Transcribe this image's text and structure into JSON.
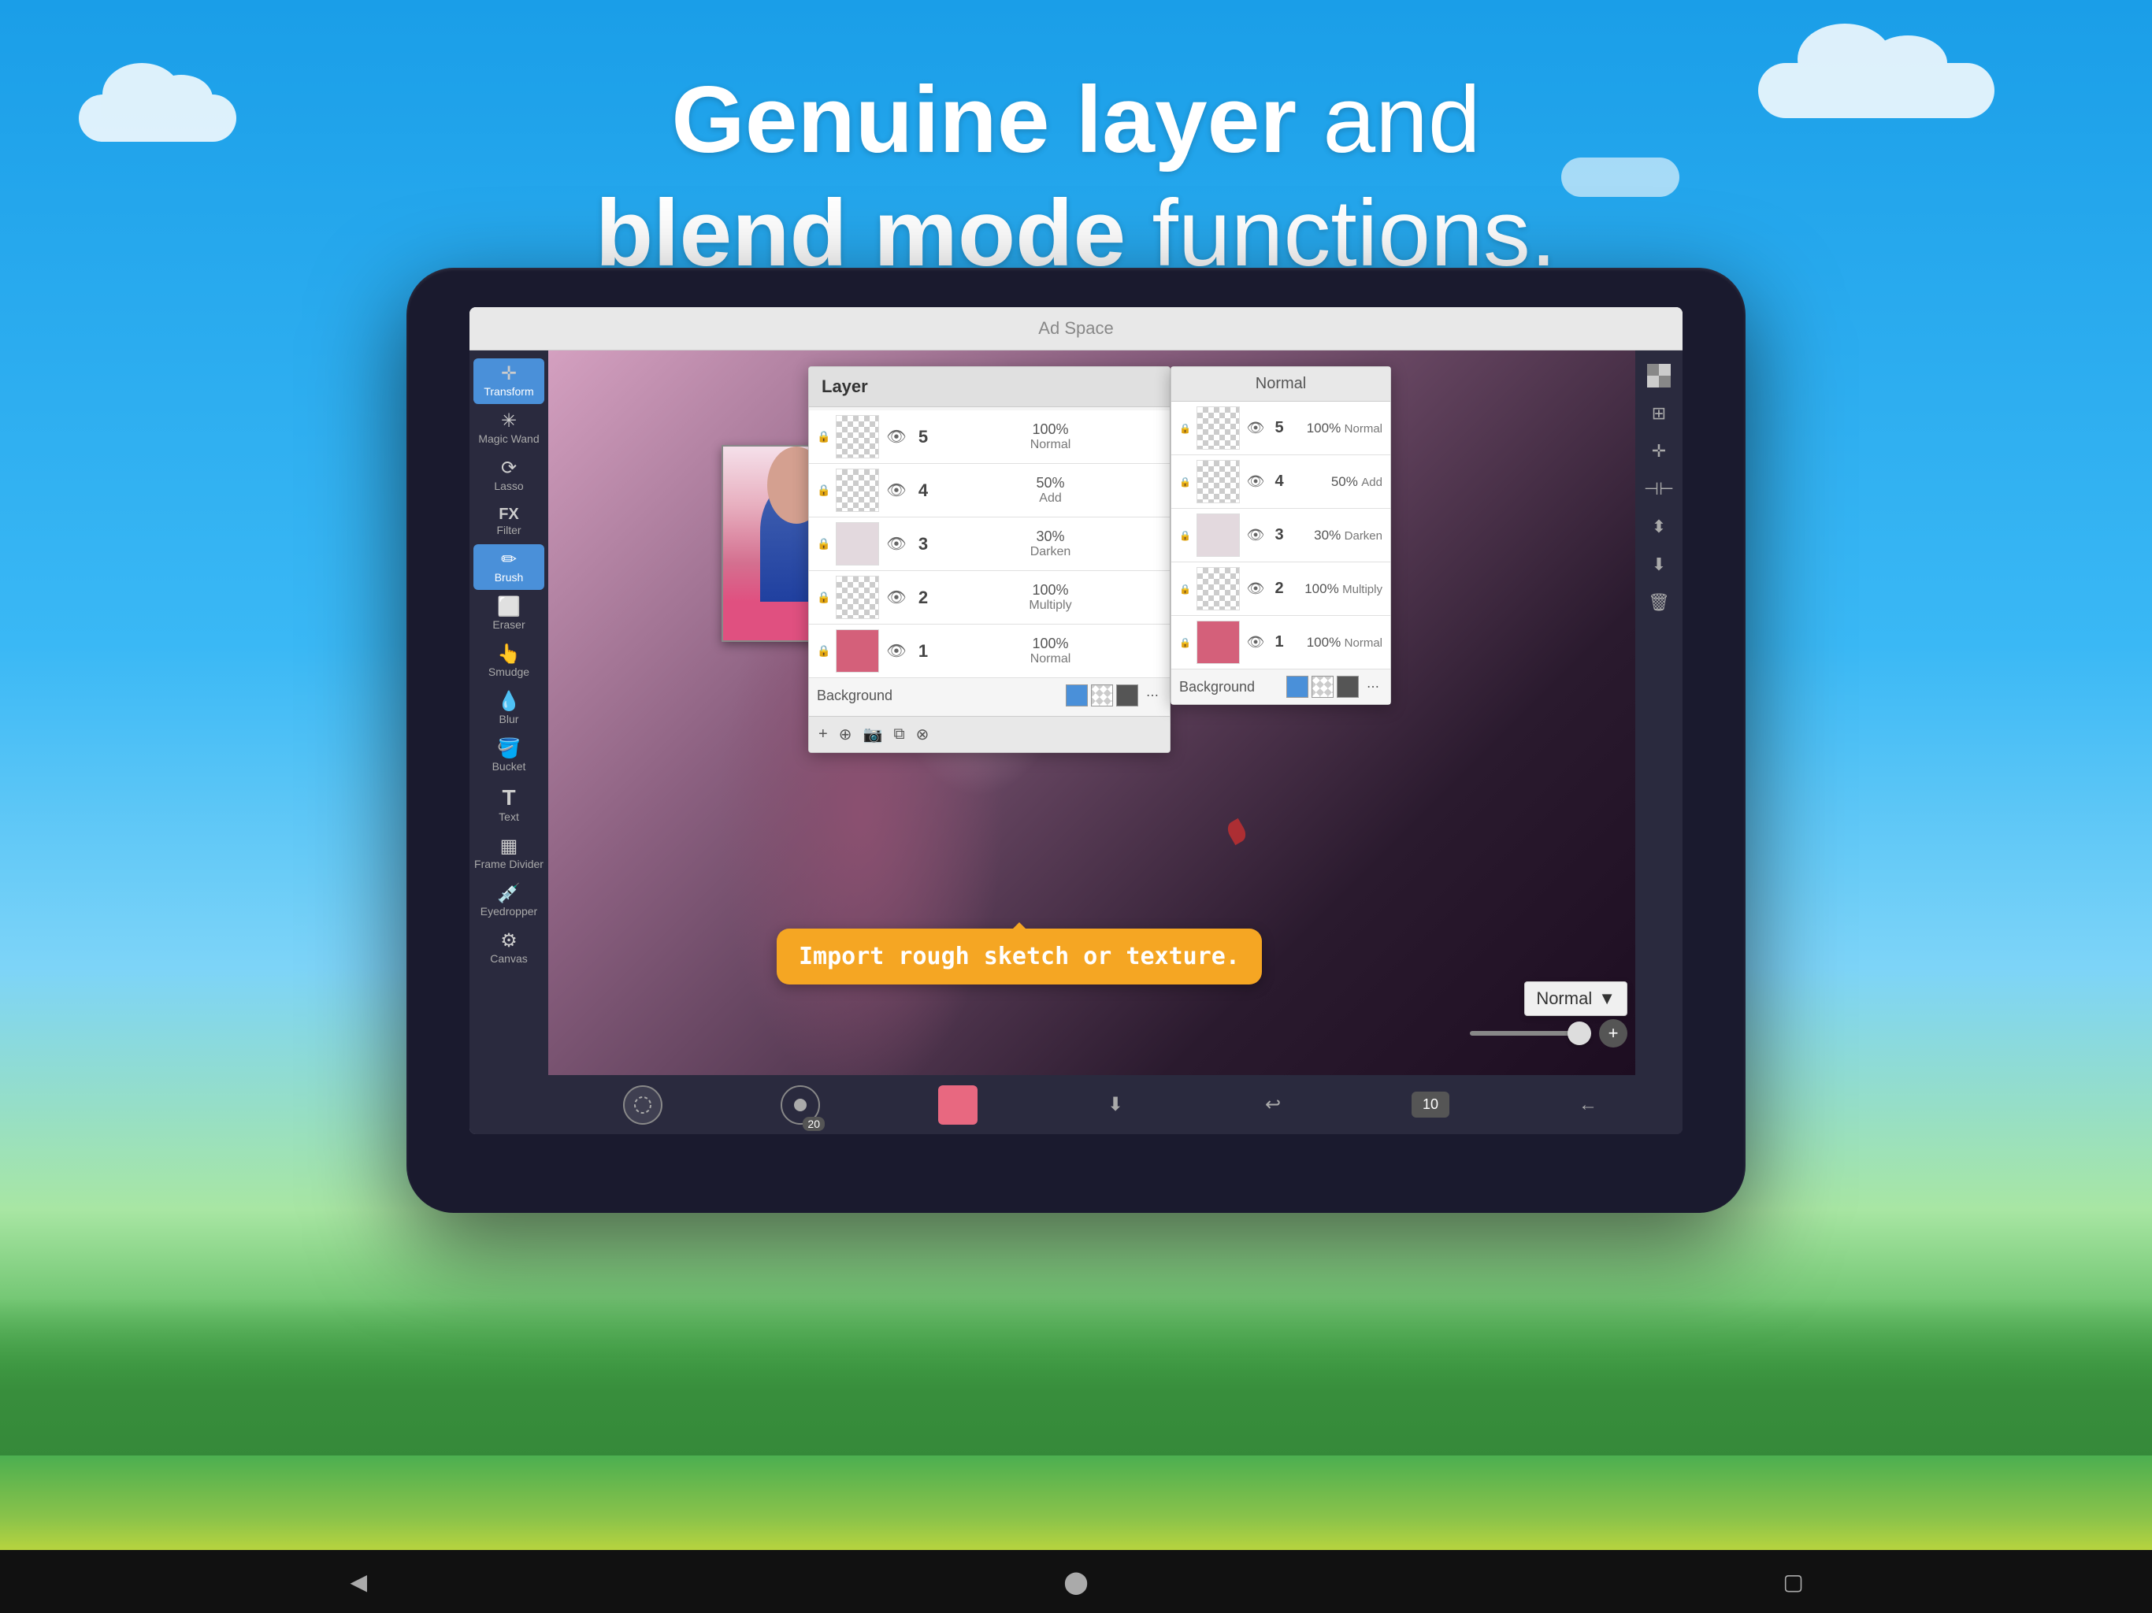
{
  "background": {
    "sky_color_top": "#1a9ee8",
    "sky_color_bottom": "#7dd4f8",
    "forest_color": "#2e7d32"
  },
  "headline": {
    "line1_bold": "Genuine layer",
    "line1_normal": " and",
    "line2_bold": "blend mode",
    "line2_normal": " functions."
  },
  "ad_space": {
    "label": "Ad Space"
  },
  "left_toolbar": {
    "tools": [
      {
        "id": "transform",
        "label": "Transform",
        "icon": "✛"
      },
      {
        "id": "magic_wand",
        "label": "Magic Wand",
        "icon": "✳"
      },
      {
        "id": "lasso",
        "label": "Lasso",
        "icon": "⟳"
      },
      {
        "id": "filter",
        "label": "Filter",
        "icon": "FX"
      },
      {
        "id": "brush",
        "label": "Brush",
        "icon": "✏",
        "active": true
      },
      {
        "id": "eraser",
        "label": "Eraser",
        "icon": "⬜"
      },
      {
        "id": "smudge",
        "label": "Smudge",
        "icon": "👆"
      },
      {
        "id": "blur",
        "label": "Blur",
        "icon": "💧"
      },
      {
        "id": "bucket",
        "label": "Bucket",
        "icon": "🪣"
      },
      {
        "id": "text",
        "label": "Text",
        "icon": "T"
      },
      {
        "id": "frame_divider",
        "label": "Frame Divider",
        "icon": "▦"
      },
      {
        "id": "eyedropper",
        "label": "Eyedropper",
        "icon": "💉"
      },
      {
        "id": "canvas",
        "label": "Canvas",
        "icon": "⚙"
      }
    ]
  },
  "layer_panel": {
    "title": "Layer",
    "layers": [
      {
        "number": 5,
        "opacity": "100%",
        "blend": "Normal",
        "visible": true
      },
      {
        "number": 4,
        "opacity": "50%",
        "blend": "Add",
        "visible": true
      },
      {
        "number": 3,
        "opacity": "30%",
        "blend": "Darken",
        "visible": true
      },
      {
        "number": 2,
        "opacity": "100%",
        "blend": "Multiply",
        "visible": true
      },
      {
        "number": 1,
        "opacity": "100%",
        "blend": "Normal",
        "visible": true
      }
    ],
    "background_label": "Background",
    "bottom_buttons": [
      "+",
      "⊕",
      "📷",
      "⧉",
      "⊗"
    ]
  },
  "blend_panel": {
    "header": "Normal",
    "layers": [
      {
        "number": 5,
        "opacity": "100%",
        "blend": "Normal",
        "visible": true
      },
      {
        "number": 4,
        "opacity": "50%",
        "blend": "Add",
        "visible": true
      },
      {
        "number": 3,
        "opacity": "30%",
        "blend": "Darken",
        "visible": true
      },
      {
        "number": 2,
        "opacity": "100%",
        "blend": "Multiply",
        "visible": true
      },
      {
        "number": 1,
        "opacity": "100%",
        "blend": "Normal",
        "visible": true
      }
    ],
    "background_label": "Background"
  },
  "right_tools": {
    "icons": [
      "⬛",
      "⊞",
      "✛",
      "⊣⊢",
      "⬇",
      "🗑"
    ]
  },
  "bottom_bar": {
    "brush_size": "20",
    "color": "#e86880",
    "page_number": "10",
    "icons": [
      "↻",
      "↩",
      "←"
    ]
  },
  "callout": {
    "text": "Import rough sketch or texture."
  },
  "normal_dropdown": {
    "label": "Normal",
    "arrow": "▼"
  },
  "android_nav": {
    "back": "◀",
    "home": "⬤",
    "recent": "▢"
  }
}
